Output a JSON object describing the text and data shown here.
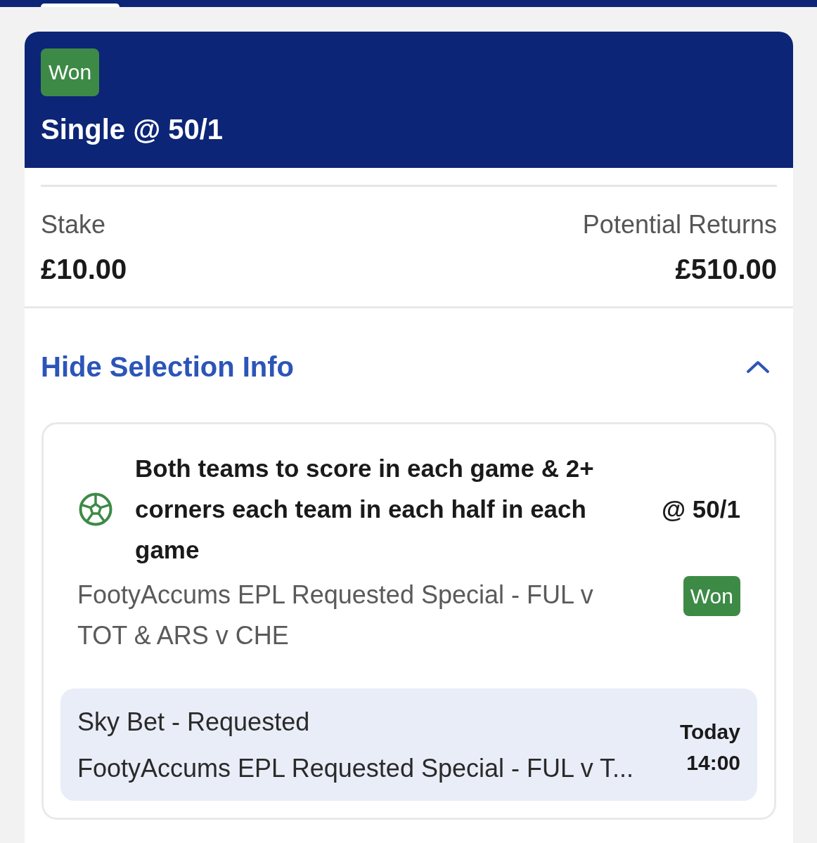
{
  "bet": {
    "status": {
      "label": "Won",
      "kind": "won"
    },
    "title": "Single @ 50/1"
  },
  "summary": [
    {
      "label": "Stake",
      "value": "£10.00"
    },
    {
      "label": "Potential Returns",
      "value": "£510.00"
    }
  ],
  "selection_toggle": {
    "label": "Hide Selection Info",
    "expanded": true
  },
  "selection": {
    "market": "Both teams to score in each game & 2+ corners each team in each half in each game",
    "odds": "@ 50/1",
    "event": "FootyAccums EPL Requested Special - FUL v TOT & ARS v CHE",
    "result": {
      "label": "Won",
      "kind": "won"
    },
    "event_box": {
      "title": "Sky Bet - Requested",
      "subtitle": "FootyAccums EPL Requested Special - FUL v T...",
      "day": "Today",
      "time": "14:00"
    }
  }
}
